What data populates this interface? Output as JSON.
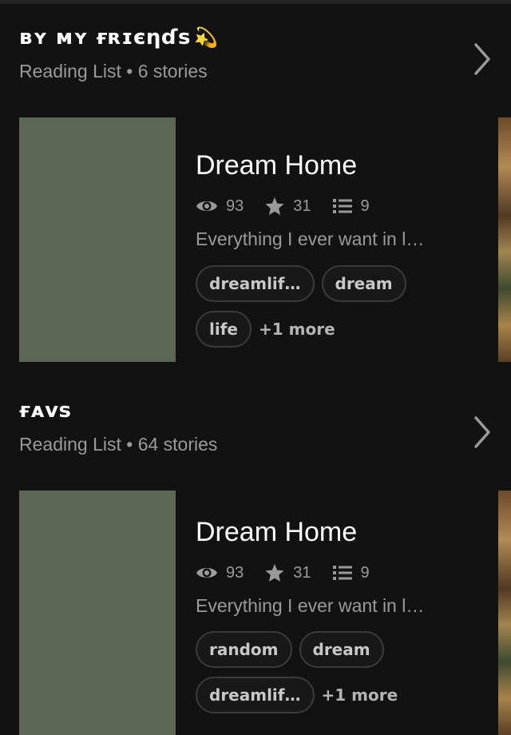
{
  "lists": [
    {
      "title": "ʙʏ ᴍʏ ғʀɪєηɗѕ",
      "emoji": "💫",
      "subtitle": "Reading List • 6 stories",
      "story": {
        "title": "Dream Home",
        "reads": "93",
        "votes": "31",
        "parts": "9",
        "description": "Everything I ever want in l…",
        "tags": [
          "dreamlif…",
          "dream",
          "life"
        ],
        "more": "+1 more"
      }
    },
    {
      "title": "ғᴀᴠѕ",
      "emoji": "",
      "subtitle": "Reading List • 64 stories",
      "story": {
        "title": "Dream Home",
        "reads": "93",
        "votes": "31",
        "parts": "9",
        "description": "Everything I ever want in l…",
        "tags": [
          "random",
          "dream",
          "dreamlif…"
        ],
        "more": "+1 more"
      }
    }
  ],
  "icons": {
    "reads": "eye-icon",
    "votes": "star-icon",
    "parts": "list-icon",
    "chevron": "chevron-right-icon"
  },
  "colors": {
    "background": "#121212",
    "muted_text": "#9a9a9a",
    "cover": "#5d6755"
  }
}
